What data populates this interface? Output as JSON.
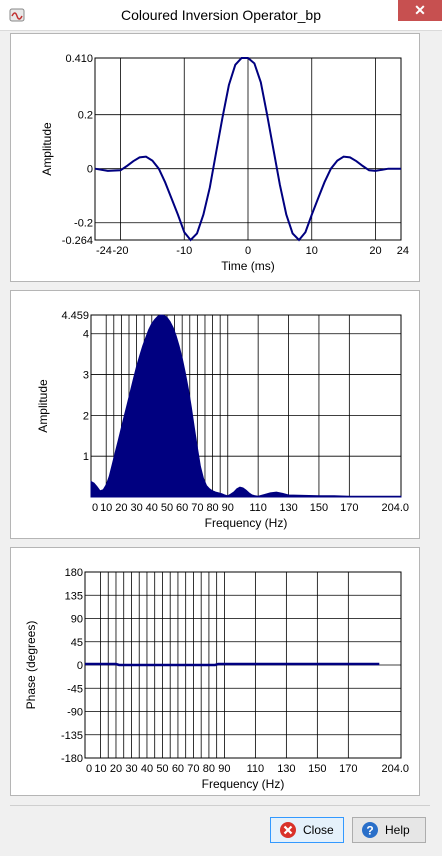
{
  "window": {
    "title": "Coloured Inversion Operator_bp",
    "close_glyph": "✕"
  },
  "buttons": {
    "close": "Close",
    "help": "Help"
  },
  "chart_data": [
    {
      "type": "line",
      "xlabel": "Time (ms)",
      "ylabel": "Amplitude",
      "xlim": [
        -24,
        24
      ],
      "ylim": [
        -0.264,
        0.41
      ],
      "xticks": [
        "-24",
        "-20",
        "-10",
        "0",
        "10",
        "20",
        "24"
      ],
      "yticks": [
        "0.410",
        "0.2",
        "0",
        "-0.2",
        "-0.264"
      ],
      "color": "#000080",
      "series": [
        {
          "x": [
            -24,
            -22,
            -20,
            -19,
            -18,
            -17,
            -16,
            -15,
            -14,
            -13,
            -12,
            -11,
            -10,
            -9,
            -8,
            -7,
            -6,
            -5,
            -4,
            -3,
            -2,
            -1,
            0,
            1,
            2,
            3,
            4,
            5,
            6,
            7,
            8,
            9,
            10,
            11,
            12,
            13,
            14,
            15,
            16,
            17,
            18,
            19,
            20,
            22,
            24
          ],
          "y": [
            0.0,
            -0.008,
            -0.006,
            0.01,
            0.028,
            0.042,
            0.045,
            0.03,
            0.0,
            -0.05,
            -0.11,
            -0.17,
            -0.235,
            -0.264,
            -0.24,
            -0.17,
            -0.07,
            0.06,
            0.19,
            0.31,
            0.385,
            0.41,
            0.41,
            0.39,
            0.32,
            0.2,
            0.07,
            -0.06,
            -0.17,
            -0.24,
            -0.264,
            -0.235,
            -0.17,
            -0.11,
            -0.05,
            0.0,
            0.03,
            0.045,
            0.042,
            0.028,
            0.01,
            -0.006,
            -0.008,
            0.0,
            0.0
          ]
        }
      ]
    },
    {
      "type": "area",
      "xlabel": "Frequency (Hz)",
      "ylabel": "Amplitude",
      "xlim": [
        0,
        204
      ],
      "ylim": [
        0,
        4.459
      ],
      "xticks": [
        "0",
        "10",
        "20",
        "30",
        "40",
        "50",
        "60",
        "70",
        "80",
        "90",
        "110",
        "130",
        "150",
        "170",
        "204.0"
      ],
      "yticks": [
        "4.459",
        "4",
        "3",
        "2",
        "1"
      ],
      "color": "#000080",
      "series": [
        {
          "x": [
            0,
            2,
            4,
            6,
            8,
            10,
            12,
            14,
            16,
            18,
            20,
            22,
            24,
            26,
            28,
            30,
            32,
            34,
            36,
            38,
            40,
            42,
            44,
            46,
            48,
            50,
            52,
            54,
            56,
            58,
            60,
            62,
            64,
            66,
            68,
            70,
            72,
            74,
            76,
            78,
            80,
            82,
            84,
            86,
            88,
            90,
            92,
            94,
            96,
            98,
            100,
            102,
            104,
            106,
            108,
            110,
            114,
            118,
            122,
            126,
            130,
            140,
            150,
            160,
            170,
            180,
            190,
            200,
            204
          ],
          "y": [
            0.38,
            0.34,
            0.25,
            0.15,
            0.18,
            0.3,
            0.5,
            0.8,
            1.1,
            1.4,
            1.7,
            2.0,
            2.3,
            2.6,
            2.9,
            3.2,
            3.45,
            3.7,
            3.9,
            4.1,
            4.25,
            4.35,
            4.43,
            4.459,
            4.45,
            4.4,
            4.3,
            4.15,
            3.95,
            3.7,
            3.4,
            3.05,
            2.65,
            2.2,
            1.7,
            1.2,
            0.75,
            0.45,
            0.28,
            0.2,
            0.15,
            0.12,
            0.1,
            0.08,
            0.05,
            0.03,
            0.07,
            0.12,
            0.2,
            0.24,
            0.22,
            0.17,
            0.1,
            0.05,
            0.03,
            0.02,
            0.06,
            0.1,
            0.12,
            0.09,
            0.05,
            0.04,
            0.03,
            0.03,
            0.02,
            0.02,
            0.02,
            0.02,
            0.02
          ]
        }
      ]
    },
    {
      "type": "line",
      "xlabel": "Frequency (Hz)",
      "ylabel": "Phase (degrees)",
      "xlim": [
        0,
        204
      ],
      "ylim": [
        -180,
        180
      ],
      "xticks": [
        "0",
        "10",
        "20",
        "30",
        "40",
        "50",
        "60",
        "70",
        "80",
        "90",
        "110",
        "130",
        "150",
        "170",
        "204.0"
      ],
      "yticks": [
        "180",
        "135",
        "90",
        "45",
        "0",
        "-45",
        "-90",
        "-135",
        "-180"
      ],
      "color": "#000080",
      "series": [
        {
          "x": [
            0,
            20,
            22,
            84,
            86,
            190
          ],
          "y": [
            2,
            2,
            0,
            0,
            2,
            2
          ]
        }
      ]
    }
  ]
}
